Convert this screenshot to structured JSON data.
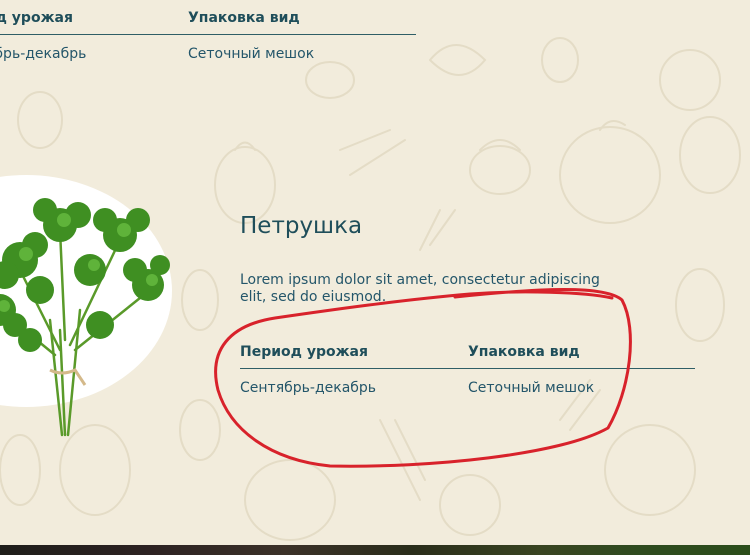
{
  "top_table": {
    "headers": [
      "од урожая",
      "Упаковка вид"
    ],
    "row": [
      "ябрь-декабрь",
      "Сеточный мешок"
    ]
  },
  "product": {
    "title": "Петрушка",
    "description": "Lorem ipsum dolor sit amet, consectetur adipiscing elit, sed do eiusmod.",
    "image_icon": "parsley-image",
    "table": {
      "headers": [
        "Период урожая",
        "Упаковка вид"
      ],
      "row": [
        "Сентябрь-декабрь",
        "Сеточный мешок"
      ]
    }
  },
  "colors": {
    "background": "#f2ecdc",
    "heading": "#1f4e5a",
    "text": "#24566a",
    "annotation": "#d8222b"
  }
}
